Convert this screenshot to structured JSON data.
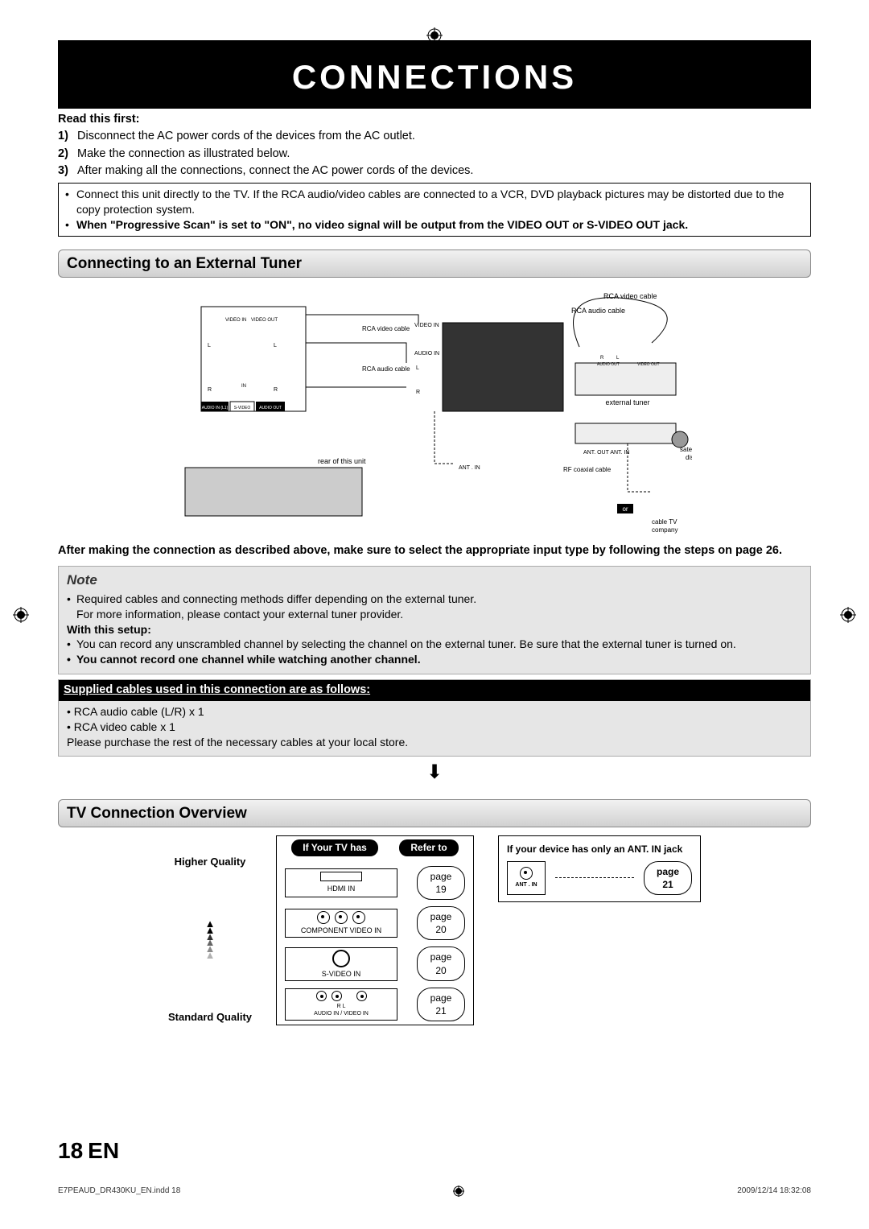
{
  "title": "CONNECTIONS",
  "read_first_heading": "Read this first:",
  "steps": [
    "Disconnect the AC power cords of the devices from the AC outlet.",
    "Make the connection as illustrated below.",
    "After making all the connections, connect the AC power cords of the devices."
  ],
  "info_box": {
    "line1": "Connect this unit directly to the TV. If the RCA audio/video cables are connected to a VCR, DVD playback pictures may be distorted due to the copy protection system.",
    "line2_bold": "When \"Progressive Scan\" is set to \"ON\", no video signal will be output from the VIDEO OUT or S-VIDEO OUT jack."
  },
  "section1": "Connecting to an External Tuner",
  "diagram_labels": {
    "rca_video_cable": "RCA video cable",
    "rca_audio_cable": "RCA audio cable",
    "video_in": "VIDEO IN",
    "audio_in": "AUDIO IN",
    "l": "L",
    "r": "R",
    "audio_out": "AUDIO OUT",
    "video_out": "VIDEO OUT",
    "rear": "rear of this unit",
    "ant_in": "ANT. IN",
    "ant_out": "ANT. OUT",
    "rf": "RF coaxial cable",
    "ext_tuner": "external tuner",
    "sat": "satellite dish",
    "or": "or",
    "cable_co": "cable TV company",
    "video_in_out": "VIDEO IN / VIDEO OUT",
    "audio_in_l1": "AUDIO IN (L1)",
    "s_video": "S-VIDEO",
    "in": "IN"
  },
  "after_diagram": "After making the connection as described above, make sure to select the appropriate input type by following the steps on page 26.",
  "note": {
    "heading": "Note",
    "l1": "Required cables and connecting methods differ depending on the external tuner.",
    "l2": "For more information, please contact your external tuner provider.",
    "with_setup": "With this setup:",
    "l3": "You can record any unscrambled channel by selecting the channel on the external tuner. Be sure that the external tuner is turned on.",
    "l4_bold": "You cannot record one channel while watching another channel."
  },
  "supplied": {
    "heading": "Supplied cables used in this connection are as follows:",
    "i1": "RCA audio cable (L/R) x 1",
    "i2": "RCA video cable x 1",
    "rest": "Please purchase the rest of the necessary cables at your local store."
  },
  "section2": "TV Connection Overview",
  "quality": {
    "high": "Higher Quality",
    "std": "Standard Quality"
  },
  "overview": {
    "head_left": "If Your TV has",
    "head_right": "Refer to",
    "rows": [
      {
        "label": "HDMI IN",
        "page_word": "page",
        "page_num": "19",
        "kind": "hdmi"
      },
      {
        "label": "COMPONENT VIDEO IN",
        "page_word": "page",
        "page_num": "20",
        "kind": "component"
      },
      {
        "label": "S-VIDEO IN",
        "page_word": "page",
        "page_num": "20",
        "kind": "svideo"
      },
      {
        "label": "AUDIO IN / VIDEO IN",
        "sublabel": "R   L",
        "page_word": "page",
        "page_num": "21",
        "kind": "rca"
      }
    ]
  },
  "antin": {
    "text": "If your device has only an ANT. IN jack",
    "label": "ANT . IN",
    "page_word": "page",
    "page_num": "21"
  },
  "footer": {
    "page": "18",
    "lang": "EN"
  },
  "print": {
    "left": "E7PEAUD_DR430KU_EN.indd   18",
    "right": "2009/12/14   18:32:08"
  }
}
